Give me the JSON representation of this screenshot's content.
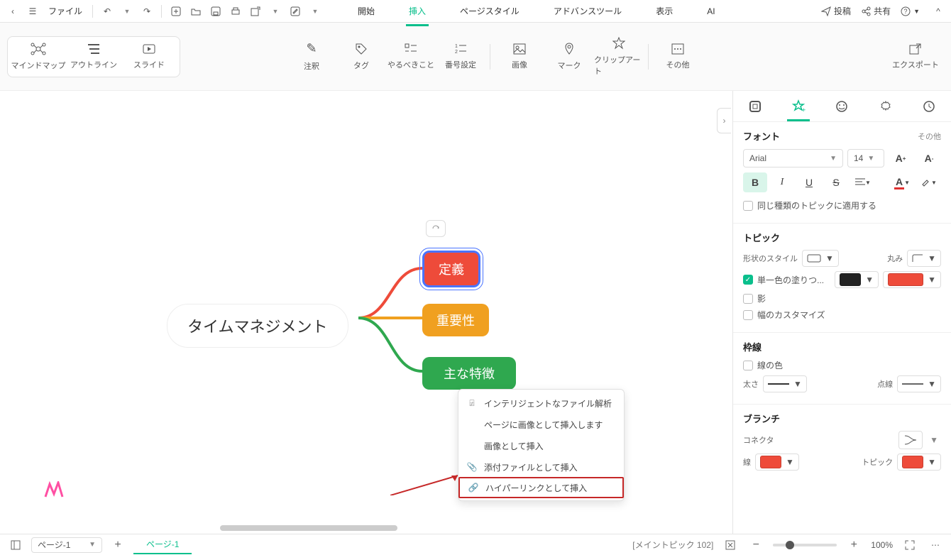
{
  "topbar": {
    "file_label": "ファイル",
    "tabs": [
      "開始",
      "挿入",
      "ページスタイル",
      "アドバンスツール",
      "表示",
      "AI"
    ],
    "active_tab_index": 1,
    "post": "投稿",
    "share": "共有"
  },
  "ribbon": {
    "left": [
      {
        "label": "マインドマップ"
      },
      {
        "label": "アウトライン"
      },
      {
        "label": "スライド"
      }
    ],
    "center": [
      {
        "label": "注釈"
      },
      {
        "label": "タグ"
      },
      {
        "label": "やるべきこと"
      },
      {
        "label": "番号設定"
      },
      {
        "label": "画像"
      },
      {
        "label": "マーク"
      },
      {
        "label": "クリップアート"
      },
      {
        "label": "その他"
      }
    ],
    "export": "エクスポート"
  },
  "mindmap": {
    "center": "タイムマネジメント",
    "children": [
      "定義",
      "重要性",
      "主な特徴"
    ]
  },
  "context_menu": [
    {
      "label": "インテリジェントなファイル解析",
      "icon": "scan"
    },
    {
      "label": "ページに画像として挿入します",
      "icon": ""
    },
    {
      "label": "画像として挿入",
      "icon": ""
    },
    {
      "label": "添付ファイルとして挿入",
      "icon": "clip"
    },
    {
      "label": "ハイパーリンクとして挿入",
      "icon": "link",
      "highlight": true
    }
  ],
  "rpanel": {
    "font_section": "フォント",
    "more": "その他",
    "font_name": "Arial",
    "font_size": "14",
    "apply_same": "同じ種類のトピックに適用する",
    "topic_section": "トピック",
    "shape_style": "形状のスタイル",
    "round": "丸み",
    "fill_label": "単一色の塗りつ...",
    "fill_swatch_primary": "#222222",
    "fill_swatch_secondary": "#ee4b3a",
    "shadow": "影",
    "custom_width": "幅のカスタマイズ",
    "border_section": "枠線",
    "border_color": "線の色",
    "thickness": "太さ",
    "dotted": "点線",
    "branch_section": "ブランチ",
    "connector": "コネクタ",
    "line": "線",
    "topic_lbl": "トピック",
    "branch_swatch": "#ee4b3a"
  },
  "status": {
    "page_dd": "ページ-1",
    "page_tab": "ページ-1",
    "meta": "[メイントピック 102]",
    "zoom": "100%"
  }
}
